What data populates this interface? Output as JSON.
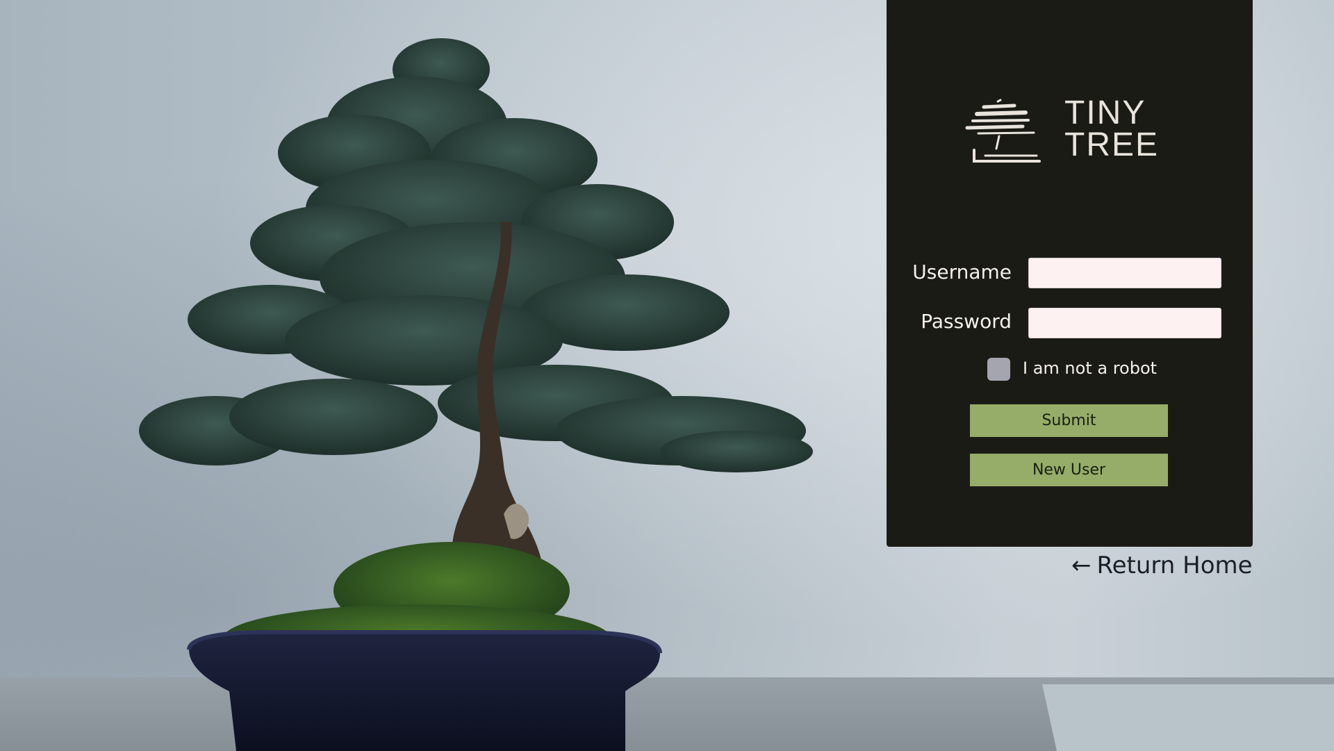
{
  "brand": {
    "line1": "TINY",
    "line2": "TREE",
    "logo_icon": "bonsai-brushstroke-icon"
  },
  "form": {
    "username_label": "Username",
    "username_value": "",
    "password_label": "Password",
    "password_value": "",
    "captcha_label": "I am not a robot",
    "captcha_checked": false,
    "submit_label": "Submit",
    "new_user_label": "New User"
  },
  "nav": {
    "return_arrow": "←",
    "return_label": "Return Home"
  },
  "colors": {
    "panel_bg": "#1b1b16",
    "button_bg": "#95ad68",
    "input_bg": "#fdf1f2",
    "checkbox_bg": "#a5a5b0",
    "text_light": "#f4f1ea"
  },
  "background": {
    "subject": "bonsai tree in a dark blue pot on grey stone, pale blue-grey wall"
  }
}
